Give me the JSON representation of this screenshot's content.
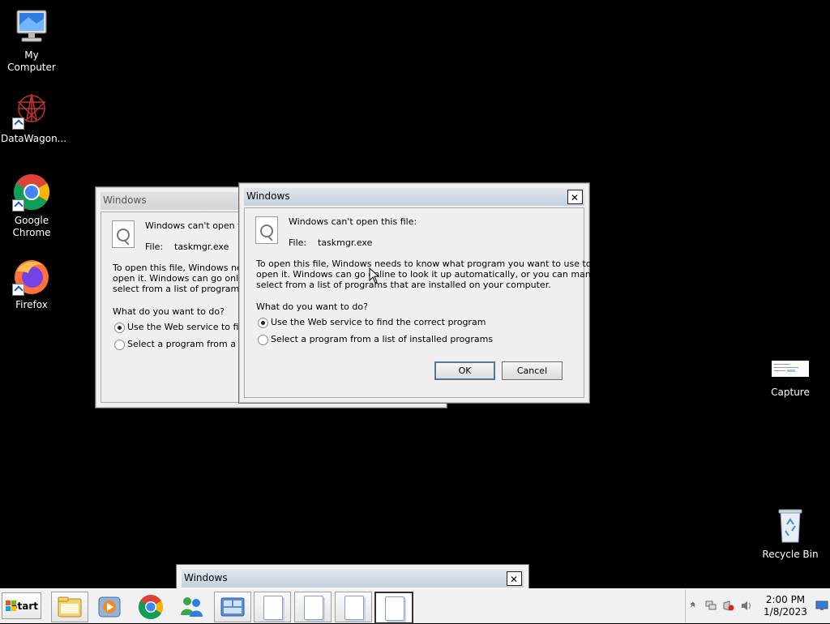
{
  "desktop": {
    "icons": [
      {
        "label": "My Computer",
        "icon": "computer-icon"
      },
      {
        "label": "DataWagon...",
        "icon": "datawagon-icon"
      },
      {
        "label": "Google Chrome",
        "icon": "chrome-icon"
      },
      {
        "label": "Firefox",
        "icon": "firefox-icon"
      },
      {
        "label": "Capture",
        "icon": "capture-thumbnail-icon"
      },
      {
        "label": "Recycle Bin",
        "icon": "recycle-bin-icon"
      }
    ]
  },
  "dialog_back": {
    "title": "Windows",
    "heading": "Windows can't open this",
    "file_label": "File:",
    "file_name": "taskmgr.exe",
    "para_line1": "To open this file, Windows needs",
    "para_line2": "open it. Windows can go online t",
    "para_line3": "select from a list of programs tha",
    "question": "What do you want to do?",
    "option1": "Use the Web service to find t",
    "option2": "Select a program from a list c"
  },
  "dialog_front": {
    "title": "Windows",
    "close": "✕",
    "heading": "Windows can't open this file:",
    "file_label": "File:",
    "file_name": "taskmgr.exe",
    "para_line1": "To open this file, Windows needs to know what program you want to use to",
    "para_line2": "open it. Windows can go online to look it up automatically, or you can manually",
    "para_line3": "select from a list of programs that are installed on your computer.",
    "question": "What do you want to do?",
    "option1": "Use the Web service to find the correct program",
    "option2": "Select a program from a list of installed programs",
    "option1_selected": true,
    "ok": "OK",
    "cancel": "Cancel"
  },
  "bottom_window": {
    "title": "Windows",
    "close": "✕"
  },
  "taskbar": {
    "start": "Start",
    "pinned": [
      "explorer-icon",
      "media-player-icon",
      "chrome-icon",
      "messenger-icon",
      "control-panel-icon",
      "document-icon",
      "document-icon",
      "document-icon",
      "document-icon"
    ],
    "tray": {
      "show_hidden": "»",
      "time": "2:00 PM",
      "date": "1/8/2023"
    }
  },
  "colors": {
    "desktop": "#000000",
    "dialog_bg": "#f0f0f0",
    "titlebar": "#c5d1de"
  }
}
